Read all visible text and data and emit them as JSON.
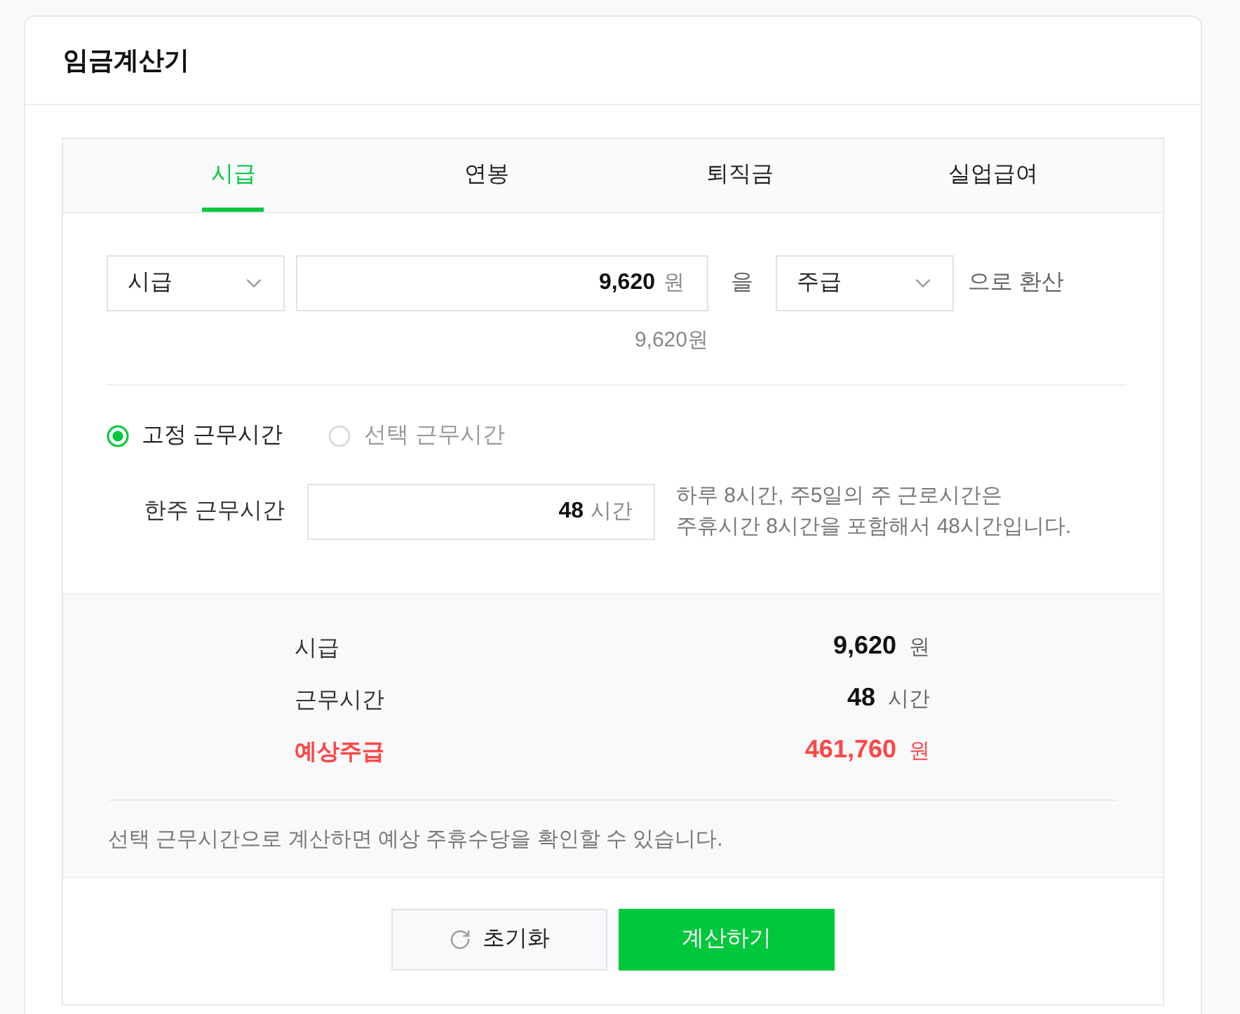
{
  "header": {
    "title": "임금계산기"
  },
  "tabs": [
    {
      "label": "시급",
      "selected": true
    },
    {
      "label": "연봉",
      "selected": false
    },
    {
      "label": "퇴직금",
      "selected": false
    },
    {
      "label": "실업급여",
      "selected": false
    }
  ],
  "converter": {
    "from_select": {
      "value": "시급"
    },
    "amount": {
      "value": "9,620",
      "unit": "원"
    },
    "particle": "을",
    "to_select": {
      "value": "주급"
    },
    "suffix": "으로 환산",
    "converted": "9,620원"
  },
  "work_type": [
    {
      "label": "고정 근무시간",
      "selected": true
    },
    {
      "label": "선택 근무시간",
      "selected": false
    }
  ],
  "weekly_hours": {
    "label": "한주 근무시간",
    "value": "48",
    "unit": "시간",
    "help_lines": [
      "하루 8시간, 주5일의 주 근로시간은",
      "주휴시간 8시간을 포함해서 48시간입니다."
    ]
  },
  "summary": {
    "rows": [
      {
        "label": "시급",
        "value": "9,620",
        "unit": "원",
        "kind": "normal"
      },
      {
        "label": "근무시간",
        "value": "48",
        "unit": "시간",
        "kind": "normal"
      },
      {
        "label": "예상주급",
        "value": "461,760",
        "unit": "원",
        "kind": "highlight"
      }
    ],
    "note": "선택 근무시간으로 계산하면 예상 주휴수당을 확인할 수 있습니다."
  },
  "buttons": [
    {
      "label": "초기화",
      "kind": "reset"
    },
    {
      "label": "계산하기",
      "kind": "primary"
    }
  ]
}
